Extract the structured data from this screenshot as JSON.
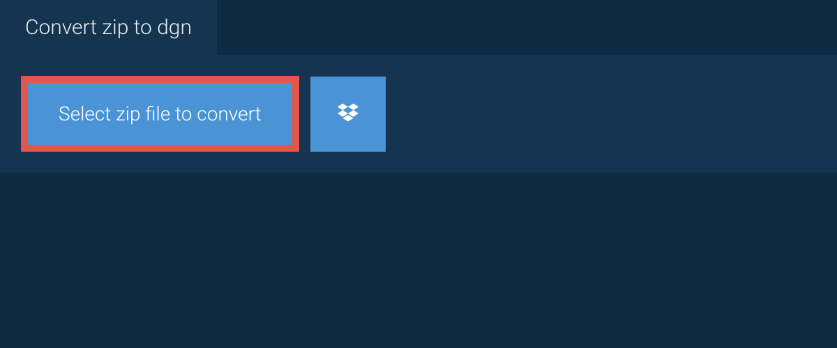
{
  "tab": {
    "label": "Convert zip to dgn"
  },
  "actions": {
    "select_label": "Select zip file to convert"
  },
  "colors": {
    "bg": "#0f2a43",
    "panel": "#14344f",
    "button": "#4a94d6",
    "border": "#e2574c",
    "text": "#ffffff"
  }
}
